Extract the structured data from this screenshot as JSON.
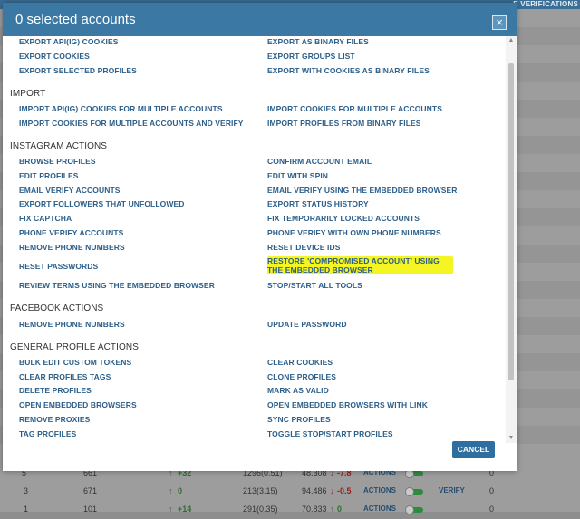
{
  "background": {
    "header_label": "E VERIFICATIONS",
    "rows": [
      {
        "c1": "5",
        "c2": "661",
        "c3": "+32",
        "c4": "1296(0.51)",
        "c5": "48.308",
        "c6": "-7.8",
        "action": "ACTIONS",
        "verify": "",
        "last": "0"
      },
      {
        "c1": "3",
        "c2": "671",
        "c3": "0",
        "c4": "213(3.15)",
        "c5": "94.486",
        "c6": "-0.5",
        "action": "ACTIONS",
        "verify": "VERIFY",
        "last": "0"
      },
      {
        "c1": "1",
        "c2": "101",
        "c3": "+14",
        "c4": "291(0.35)",
        "c5": "70.833",
        "c6": "0",
        "action": "ACTIONS",
        "verify": "",
        "last": "0"
      }
    ]
  },
  "modal": {
    "title": "0 selected accounts",
    "close_icon": "×",
    "cancel_label": "CANCEL",
    "export_partial": {
      "left": [
        "EXPORT API(IG) COOKIES",
        "EXPORT COOKIES",
        "EXPORT SELECTED PROFILES"
      ],
      "right": [
        "EXPORT AS BINARY FILES",
        "EXPORT GROUPS LIST",
        "EXPORT WITH COOKIES AS BINARY FILES"
      ]
    },
    "import": {
      "title": "IMPORT",
      "left": [
        "IMPORT API(IG) COOKIES FOR MULTIPLE ACCOUNTS",
        "IMPORT COOKIES FOR MULTIPLE ACCOUNTS AND VERIFY"
      ],
      "right": [
        "IMPORT COOKIES FOR MULTIPLE ACCOUNTS",
        "IMPORT PROFILES FROM BINARY FILES"
      ]
    },
    "instagram": {
      "title": "INSTAGRAM ACTIONS",
      "left": [
        "BROWSE PROFILES",
        "EDIT PROFILES",
        "EMAIL VERIFY ACCOUNTS",
        "EXPORT FOLLOWERS THAT UNFOLLOWED",
        "FIX CAPTCHA",
        "PHONE VERIFY ACCOUNTS",
        "REMOVE PHONE NUMBERS",
        "RESET PASSWORDS",
        "REVIEW TERMS USING THE EMBEDDED BROWSER"
      ],
      "right": [
        "CONFIRM ACCOUNT EMAIL",
        "EDIT WITH SPIN",
        "EMAIL VERIFY USING THE EMBEDDED BROWSER",
        "EXPORT STATUS HISTORY",
        "FIX TEMPORARILY LOCKED ACCOUNTS",
        "PHONE VERIFY WITH OWN PHONE NUMBERS",
        "RESET DEVICE IDS",
        "RESTORE 'COMPROMISED ACCOUNT' USING THE EMBEDDED BROWSER",
        "STOP/START ALL TOOLS"
      ]
    },
    "facebook": {
      "title": "FACEBOOK ACTIONS",
      "left": [
        "REMOVE PHONE NUMBERS"
      ],
      "right": [
        "UPDATE PASSWORD"
      ]
    },
    "general": {
      "title": "GENERAL PROFILE ACTIONS",
      "left": [
        "BULK EDIT CUSTOM TOKENS",
        "CLEAR PROFILES TAGS",
        "DELETE PROFILES",
        "OPEN EMBEDDED BROWSERS",
        "REMOVE PROXIES",
        "TAG PROFILES"
      ],
      "right": [
        "CLEAR COOKIES",
        "CLONE PROFILES",
        "MARK AS VALID",
        "OPEN EMBEDDED BROWSERS WITH LINK",
        "SYNC PROFILES",
        "TOGGLE STOP/START PROFILES"
      ]
    },
    "highlight_color": "#f4f523",
    "link_color": "#2c5f8a",
    "header_color": "#3b78a3"
  }
}
